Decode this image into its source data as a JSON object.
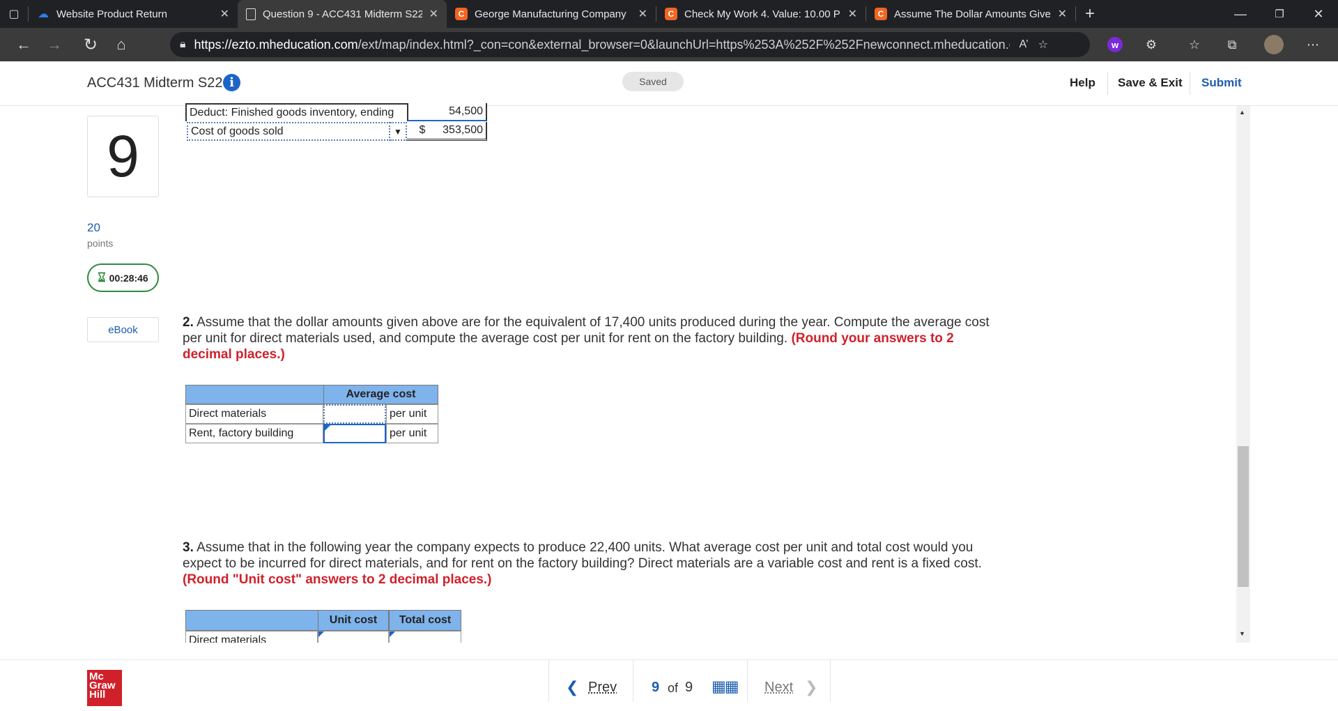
{
  "browser": {
    "tabs": [
      {
        "title": "Website Product Return",
        "favicon": "cloud-icon",
        "favicon_color": "#2b7de9"
      },
      {
        "title": "Question 9 - ACC431 Midterm S22",
        "favicon": "document-icon",
        "favicon_color": "#ffffff"
      },
      {
        "title": "George Manufacturing Company",
        "favicon": "C",
        "favicon_color": "#f26522"
      },
      {
        "title": "Check My Work 4. Value: 10.00 P",
        "favicon": "C",
        "favicon_color": "#f26522"
      },
      {
        "title": "Assume The Dollar Amounts Give",
        "favicon": "C",
        "favicon_color": "#f26522"
      }
    ],
    "url_host": "https://ezto.mheducation.com",
    "url_path": "/ext/map/index.html?_con=con&external_browser=0&launchUrl=https%253A%252F%252Fnewconnect.mheducation.co..."
  },
  "header": {
    "title": "ACC431 Midterm S22",
    "saved": "Saved",
    "help": "Help",
    "save_exit": "Save & Exit",
    "submit": "Submit"
  },
  "sidebar": {
    "question_number": "9",
    "points_value": "20",
    "points_label": "points",
    "timer": "00:28:46",
    "ebook": "eBook"
  },
  "cogs_table": {
    "row1_label": "Deduct: Finished goods inventory, ending",
    "row1_value": "54,500",
    "row2_label": "Cost of goods sold",
    "row2_currency": "$",
    "row2_value": "353,500"
  },
  "q2": {
    "number": "2.",
    "text": "Assume that the dollar amounts given above are for the equivalent of 17,400 units produced during the year. Compute the average cost per unit for direct materials used, and compute the average cost per unit for rent on the factory building.",
    "instruction": "(Round your answers to 2 decimal places.)",
    "table": {
      "header": "Average cost",
      "rows": [
        {
          "label": "Direct materials",
          "unit": "per unit"
        },
        {
          "label": "Rent, factory building",
          "unit": "per unit"
        }
      ]
    }
  },
  "q3": {
    "number": "3.",
    "text": "Assume that in the following year the company expects to produce 22,400 units. What average cost per unit and total cost would you expect to be incurred for direct materials, and for rent on the factory building? Direct materials are a variable cost and rent is a fixed cost.",
    "instruction": "(Round \"Unit cost\" answers to 2 decimal places.)",
    "table": {
      "header_unit": "Unit cost",
      "header_total": "Total cost",
      "rows": [
        {
          "label": "Direct materials"
        }
      ]
    }
  },
  "footer": {
    "logo_line1": "Mc",
    "logo_line2": "Graw",
    "logo_line3": "Hill",
    "prev": "Prev",
    "current": "9",
    "of": "of",
    "total": "9",
    "next": "Next"
  },
  "colors": {
    "accent_blue": "#1d64c8",
    "header_cell": "#7fb3ec",
    "instruction_red": "#d0212b",
    "timer_green": "#2e8b3d"
  }
}
